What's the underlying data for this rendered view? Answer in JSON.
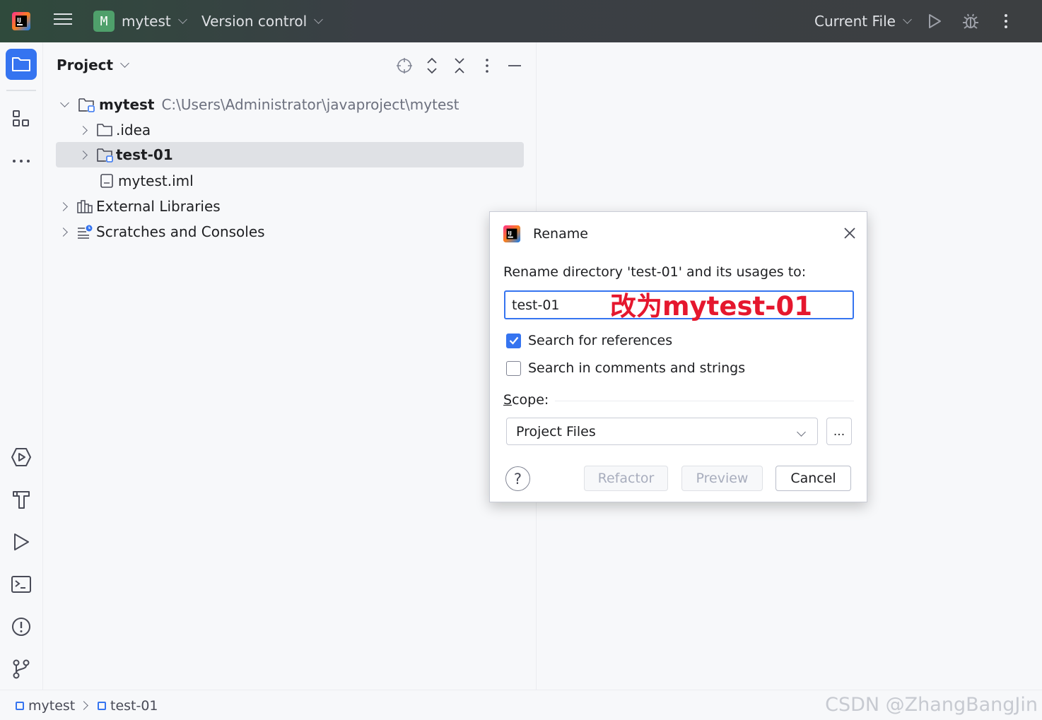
{
  "titlebar": {
    "project_badge": "M",
    "project_name": "mytest",
    "version_control": "Version control",
    "run_config": "Current File"
  },
  "panel": {
    "title": "Project",
    "tree": [
      {
        "label": "mytest",
        "path": "C:\\Users\\Administrator\\javaproject\\mytest",
        "icon": "module-folder-icon",
        "expanded": true
      },
      {
        "label": ".idea",
        "icon": "folder-icon",
        "expanded": false
      },
      {
        "label": "test-01",
        "icon": "module-folder-icon",
        "expanded": false,
        "selected": true
      },
      {
        "label": "mytest.iml",
        "icon": "file-icon"
      },
      {
        "label": "External Libraries",
        "icon": "libraries-icon",
        "expanded": false
      },
      {
        "label": "Scratches and Consoles",
        "icon": "scratches-icon",
        "expanded": false
      }
    ]
  },
  "dialog": {
    "title": "Rename",
    "prompt": "Rename directory 'test-01' and its usages to:",
    "input_value": "test-01",
    "annotation": "改为mytest-01",
    "search_references": {
      "label": "Search for references",
      "checked": true
    },
    "search_comments": {
      "label": "Search in comments and strings",
      "checked": false
    },
    "scope_label_first": "S",
    "scope_label_rest": "cope:",
    "scope_value": "Project Files",
    "dots_label": "...",
    "help_label": "?",
    "refactor_label": "Refactor",
    "preview_label": "Preview",
    "cancel_label": "Cancel"
  },
  "statusbar": {
    "crumbs": [
      "mytest",
      "test-01"
    ],
    "watermark": "CSDN @ZhangBangJin"
  },
  "colors": {
    "accent": "#3574f0",
    "annotation": "#e5172e",
    "badge": "#4fa06b"
  }
}
